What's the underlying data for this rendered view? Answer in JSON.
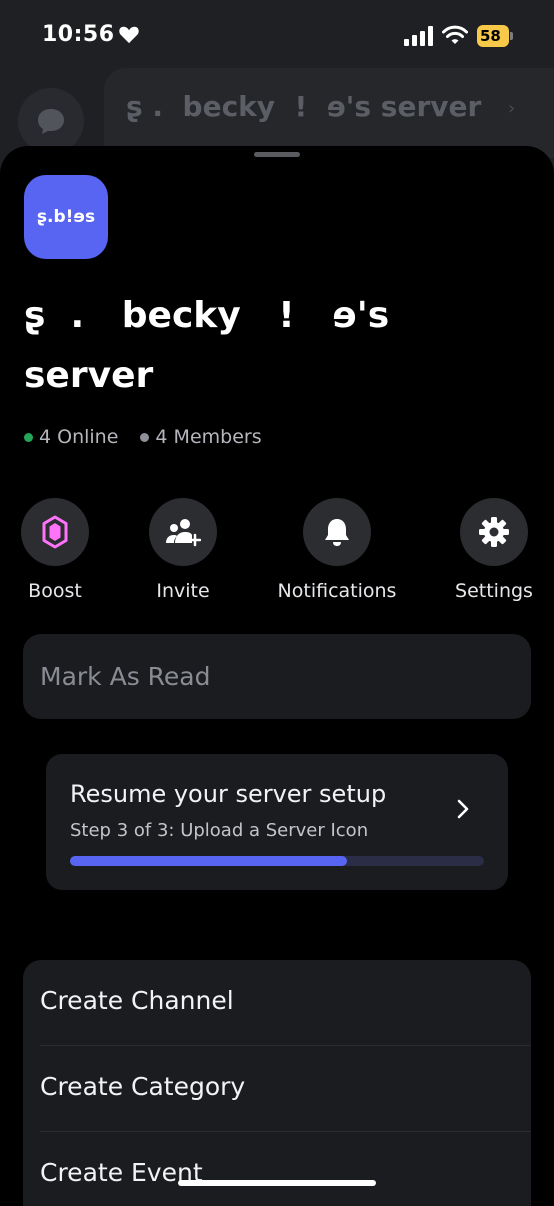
{
  "status_bar": {
    "time": "10:56",
    "battery": "58"
  },
  "background": {
    "server_name": "ʂ .  becky  !  ɘ's server",
    "chevron": "›"
  },
  "server": {
    "icon_text": "ʂ.b!ɘs",
    "title": "ʂ  .   becky   !   ɘ's server",
    "online": "4 Online",
    "members": "4 Members"
  },
  "actions": [
    {
      "label": "Boost",
      "icon": "boost-gem-icon"
    },
    {
      "label": "Invite",
      "icon": "invite-user-icon"
    },
    {
      "label": "Notifications",
      "icon": "bell-icon"
    },
    {
      "label": "Settings",
      "icon": "gear-icon"
    }
  ],
  "mark_as_read": "Mark As Read",
  "setup": {
    "title": "Resume your server setup",
    "step": "Step 3 of 3: Upload a Server Icon",
    "progress": 0.67
  },
  "create": {
    "channel": "Create Channel",
    "category": "Create Category",
    "event": "Create Event"
  },
  "colors": {
    "accent": "#5865f2",
    "online": "#23a55a",
    "boost": "#ff73fa",
    "battery": "#f7c948"
  }
}
